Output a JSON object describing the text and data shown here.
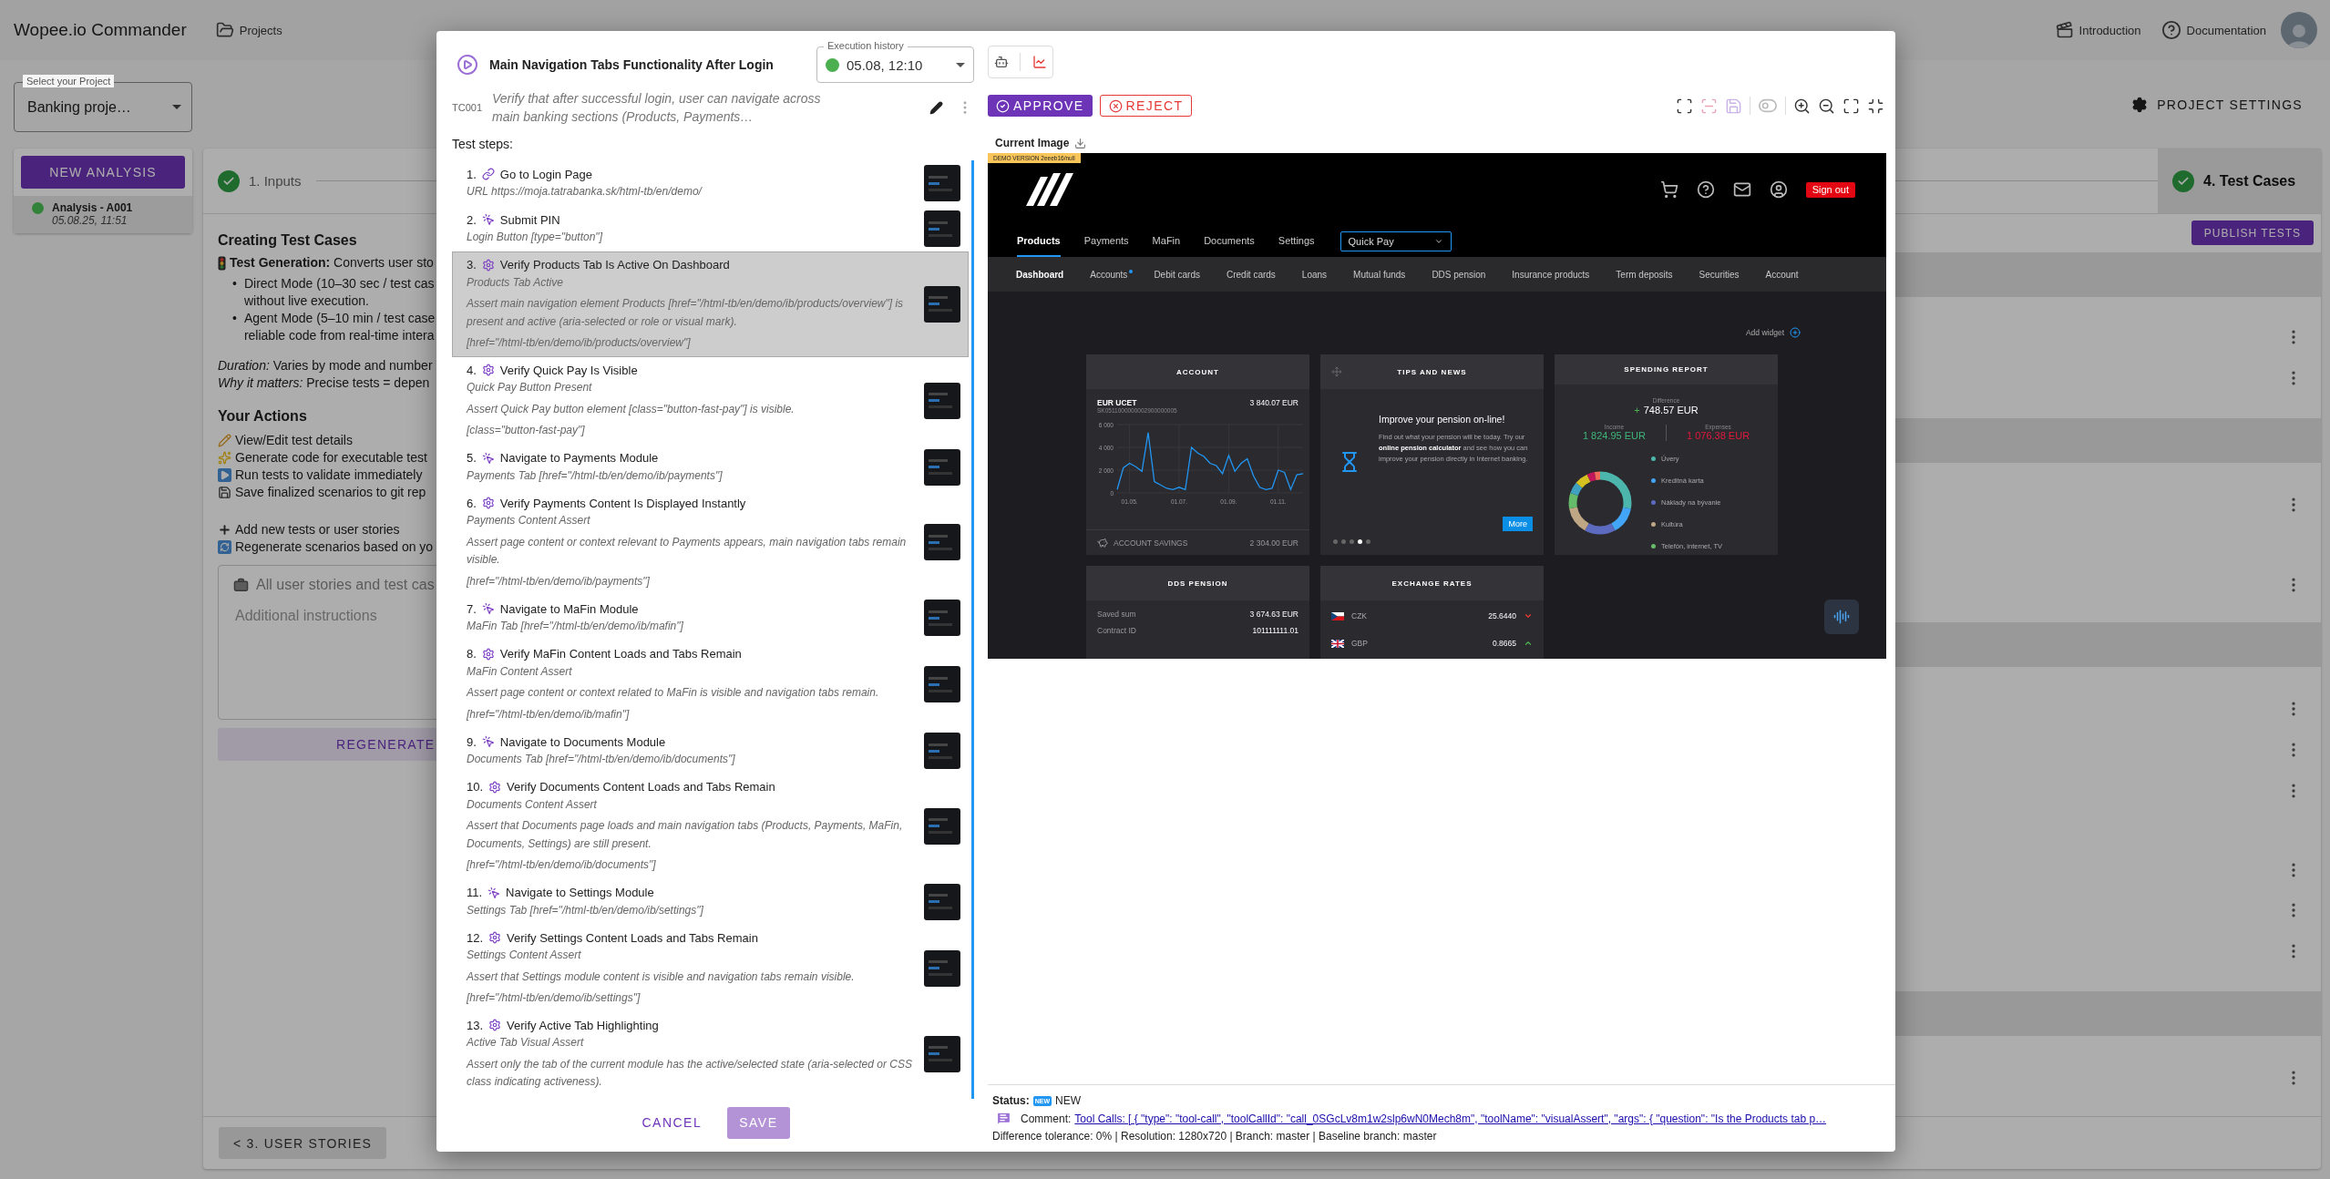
{
  "app": {
    "title": "Wopee.io Commander",
    "projects": "Projects",
    "introduction": "Introduction",
    "documentation": "Documentation"
  },
  "project_select": {
    "label": "Select your Project",
    "value": "Banking proje…"
  },
  "sidebar": {
    "new_button": "NEW ANALYSIS",
    "analyses": [
      {
        "name": "Analysis - A001",
        "date": "05.08.25, 11:51",
        "color": "#33833a",
        "selected": true
      }
    ]
  },
  "project_settings": "PROJECT SETTINGS",
  "stepper": [
    {
      "label": "1. Inputs",
      "completed": true,
      "selected": false
    },
    {
      "label": "4. Test Cases",
      "completed": true,
      "selected": true
    }
  ],
  "publish_button": "PUBLISH TESTS",
  "info": {
    "title": "Creating Test Cases",
    "generation": "**Test Generation:** Converts user sto",
    "bullets": [
      {
        "marker": "•",
        "lines": [
          "Direct Mode (10–30 sec / test cas",
          "without live execution."
        ]
      },
      {
        "marker": "•",
        "lines": [
          "Agent Mode (5–10 min / test case",
          "reliable code from real-time intera"
        ]
      }
    ],
    "notes": [
      "*Duration:* Varies by mode and number",
      "*Why it matters:* Precise tests = depen"
    ],
    "actions_title": "Your Actions",
    "actions": [
      {
        "kind": "edit",
        "text": "View/Edit test details"
      },
      {
        "kind": "generate",
        "text": "Generate code for executable test"
      },
      {
        "kind": "run",
        "text": "Run tests to validate immediately"
      },
      {
        "kind": "save",
        "text": "Save finalized scenarios to git rep"
      }
    ],
    "more_actions": [
      {
        "kind": "add",
        "text": "Add new tests or user stories"
      },
      {
        "kind": "regenerate",
        "text": "Regenerate scenarios based on yo"
      }
    ],
    "scope": "All user stories and test cas",
    "instructions_placeholder": "Additional instructions",
    "regenerate_button": "REGENERATE"
  },
  "back_button": "< 3. USER STORIES",
  "dialog": {
    "title": "Main Navigation Tabs Functionality After Login",
    "id": "TC001",
    "description": "Verify that after successful login, user can navigate across main banking sections (Products, Payments…",
    "history": {
      "label": "Execution history",
      "value": "05.08, 12:10",
      "color": "#4caf50"
    },
    "steps_label": "Test steps:",
    "steps": [
      {
        "number": "1.",
        "kind": "navigate",
        "title": "Go to Login Page",
        "target": "URL https://moja.tatrabanka.sk/html-tb/en/demo/",
        "selected": false
      },
      {
        "number": "2.",
        "kind": "click",
        "title": "Submit PIN",
        "target": "Login Button [type=\"button\"]",
        "selected": false
      },
      {
        "number": "3.",
        "kind": "assert",
        "title": "Verify Products Tab Is Active On Dashboard",
        "target": "Products Tab Active",
        "description": "Assert main navigation element Products [href=\"/html-tb/en/demo/ib/products/overview\"] is present and active (aria-selected or role or visual mark).",
        "selector": "[href=\"/html-tb/en/demo/ib/products/overview\"]",
        "selected": true
      },
      {
        "number": "4.",
        "kind": "assert",
        "title": "Verify Quick Pay Is Visible",
        "target": "Quick Pay Button Present",
        "description": "Assert Quick Pay button element [class=\"button-fast-pay\"] is visible.",
        "selector": "[class=\"button-fast-pay\"]",
        "selected": false
      },
      {
        "number": "5.",
        "kind": "click",
        "title": "Navigate to Payments Module",
        "target": "Payments Tab [href=\"/html-tb/en/demo/ib/payments\"]",
        "selected": false
      },
      {
        "number": "6.",
        "kind": "assert",
        "title": "Verify Payments Content Is Displayed Instantly",
        "target": "Payments Content Assert",
        "description": "Assert page content or context relevant to Payments appears, main navigation tabs remain visible.",
        "selector": "[href=\"/html-tb/en/demo/ib/payments\"]",
        "selected": false
      },
      {
        "number": "7.",
        "kind": "click",
        "title": "Navigate to MaFin Module",
        "target": "MaFin Tab [href=\"/html-tb/en/demo/ib/mafin\"]",
        "selected": false
      },
      {
        "number": "8.",
        "kind": "assert",
        "title": "Verify MaFin Content Loads and Tabs Remain",
        "target": "MaFin Content Assert",
        "description": "Assert page content or context related to MaFin is visible and navigation tabs remain.",
        "selector": "[href=\"/html-tb/en/demo/ib/mafin\"]",
        "selected": false
      },
      {
        "number": "9.",
        "kind": "click",
        "title": "Navigate to Documents Module",
        "target": "Documents Tab [href=\"/html-tb/en/demo/ib/documents\"]",
        "selected": false
      },
      {
        "number": "10.",
        "kind": "assert",
        "title": "Verify Documents Content Loads and Tabs Remain",
        "target": "Documents Content Assert",
        "description": "Assert that Documents page loads and main navigation tabs (Products, Payments, MaFin, Documents, Settings) are still present.",
        "selector": "[href=\"/html-tb/en/demo/ib/documents\"]",
        "selected": false
      },
      {
        "number": "11.",
        "kind": "click",
        "title": "Navigate to Settings Module",
        "target": "Settings Tab [href=\"/html-tb/en/demo/ib/settings\"]",
        "selected": false
      },
      {
        "number": "12.",
        "kind": "assert",
        "title": "Verify Settings Content Loads and Tabs Remain",
        "target": "Settings Content Assert",
        "description": "Assert that Settings module content is visible and navigation tabs remain visible.",
        "selector": "[href=\"/html-tb/en/demo/ib/settings\"]",
        "selected": false
      },
      {
        "number": "13.",
        "kind": "assert",
        "title": "Verify Active Tab Highlighting",
        "target": "Active Tab Visual Assert",
        "description": "Assert only the tab of the current module has the active/selected state (aria-selected or CSS class indicating activeness).",
        "selected": false
      }
    ],
    "cancel": "CANCEL",
    "save": "SAVE",
    "save_disabled": true
  },
  "review": {
    "approve": "APPROVE",
    "reject": "REJECT",
    "tools": [
      {
        "kind": "add-region",
        "disabled": false
      },
      {
        "kind": "remove-region",
        "disabled": true
      },
      {
        "kind": "save",
        "disabled": true
      },
      {
        "kind": "toggle",
        "disabled": true
      },
      {
        "kind": "zoom-in",
        "disabled": false
      },
      {
        "kind": "zoom-out",
        "disabled": false
      },
      {
        "kind": "fullscreen",
        "disabled": false
      },
      {
        "kind": "shrink",
        "disabled": false
      }
    ],
    "image_label": "Current Image",
    "status_label": "Status:",
    "status_badge": "NEW",
    "status": "NEW",
    "comment_label": "Comment:",
    "comment": "Tool Calls: [ { \"type\": \"tool-call\", \"toolCallId\": \"call_0SGcLv8m1w2slp6wN0Mech8m\", \"toolName\": \"visualAssert\", \"args\": { \"question\": \"Is the Products tab p…",
    "details": "Difference tolerance: 0% | Resolution: 1280x720 | Branch: master | Baseline branch: master"
  },
  "screenshot": {
    "badge": "DEMO VERSION 2eeeb16/null",
    "sign_out": "Sign out",
    "tabs": [
      {
        "label": "Products",
        "selected": true
      },
      {
        "label": "Payments",
        "selected": false
      },
      {
        "label": "MaFin",
        "selected": false
      },
      {
        "label": "Documents",
        "selected": false
      },
      {
        "label": "Settings",
        "selected": false
      }
    ],
    "quick_pay": "Quick Pay",
    "subtabs": [
      {
        "label": "Dashboard",
        "selected": true,
        "notification": false
      },
      {
        "label": "Accounts",
        "selected": false,
        "notification": true
      },
      {
        "label": "Debit cards",
        "selected": false,
        "notification": false
      },
      {
        "label": "Credit cards",
        "selected": false,
        "notification": false
      },
      {
        "label": "Loans",
        "selected": false,
        "notification": false
      },
      {
        "label": "Mutual funds",
        "selected": false,
        "notification": false
      },
      {
        "label": "DDS pension",
        "selected": false,
        "notification": false
      },
      {
        "label": "Insurance products",
        "selected": false,
        "notification": false
      },
      {
        "label": "Term deposits",
        "selected": false,
        "notification": false
      },
      {
        "label": "Securities",
        "selected": false,
        "notification": false
      },
      {
        "label": "Account",
        "selected": false,
        "notification": false
      }
    ],
    "add_widget": "Add widget",
    "account": {
      "title": "ACCOUNT",
      "name": "EUR UCET",
      "balance": "3 840.07 EUR",
      "iban": "SK0511000000002900000005",
      "savings_label": "ACCOUNT SAVINGS",
      "savings": "2 304.00 EUR",
      "chart_data": {
        "type": "line",
        "categories": [
          null,
          null,
          "01.05.",
          null,
          null,
          null,
          null,
          null,
          null,
          null,
          "01.07.",
          null,
          null,
          null,
          null,
          null,
          null,
          null,
          "01.09.",
          null,
          null,
          null,
          null,
          null,
          null,
          null,
          "01.11.",
          null,
          null,
          null,
          null
        ],
        "yticks": [
          {
            "value": 0,
            "label": "0"
          },
          {
            "value": 2000,
            "label": "2 000"
          },
          {
            "value": 4000,
            "label": "4 000"
          },
          {
            "value": 6000,
            "label": "6 000"
          }
        ],
        "ylim": [
          0,
          6000
        ],
        "grid": true,
        "series": [
          {
            "color": "#2196f3",
            "values": [
              300,
              2200,
              2600,
              2300,
              1900,
              5300,
              1000,
              700,
              400,
              300,
              500,
              300,
              4000,
              3500,
              3200,
              2600,
              2400,
              1700,
              3300,
              1900,
              2600,
              3000,
              1500,
              500,
              300,
              400,
              2000,
              1800,
              300,
              1600,
              1700
            ]
          }
        ]
      }
    },
    "tips": {
      "title": "TIPS AND NEWS",
      "headline": "Improve your pension on-line!",
      "body": "Find out what your pension will be today. Try our **online pension calculator** and see how you can improve your pension directly in Internet banking.",
      "more": "More",
      "slides": [
        {
          "selected": false
        },
        {
          "selected": false
        },
        {
          "selected": false
        },
        {
          "selected": true
        },
        {
          "selected": false
        }
      ]
    },
    "spending": {
      "title": "SPENDING REPORT",
      "difference_label": "Difference",
      "sign": "+",
      "difference": "748.57 EUR",
      "income_label": "Income",
      "income": "1 824.95 EUR",
      "expenses_label": "Expenses",
      "expenses": "1 076.38 EUR",
      "categories": [
        {
          "label": "Úvery",
          "color": "#4db6ac"
        },
        {
          "label": "Kreditná karta",
          "color": "#42a5f5"
        },
        {
          "label": "Náklady na bývanie",
          "color": "#5c6bc0"
        },
        {
          "label": "Kultúra",
          "color": "#bfa785"
        },
        {
          "label": "Telefón, internet, TV",
          "color": "#66bb6a"
        }
      ]
    },
    "pension": {
      "title": "DDS PENSION",
      "rows": [
        {
          "label": "Saved sum",
          "value": "3 674.63 EUR"
        },
        {
          "label": "Contract ID",
          "value": "101111111.01"
        }
      ]
    },
    "rates": {
      "title": "EXCHANGE RATES",
      "rows": [
        {
          "currency": "CZK",
          "kind": "cz",
          "value": "25.6440",
          "rising": false
        },
        {
          "currency": "GBP",
          "kind": "gb",
          "value": "0.8665",
          "rising": true
        }
      ]
    }
  }
}
